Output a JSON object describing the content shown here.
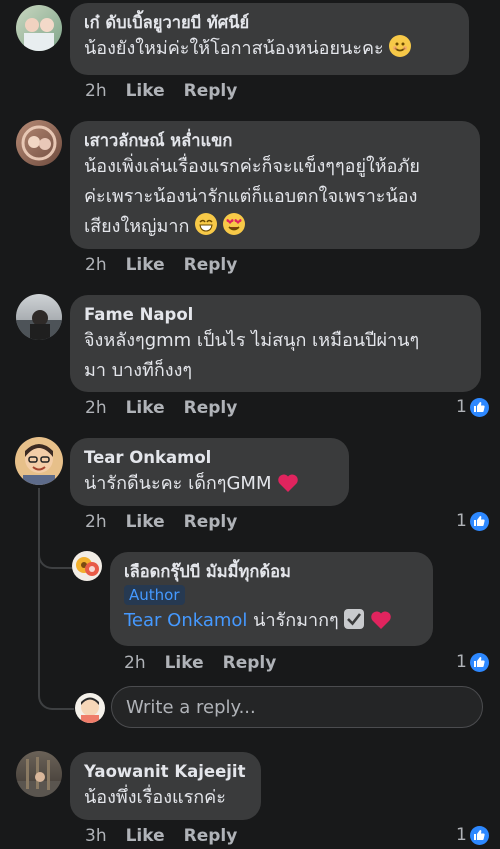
{
  "comments": [
    {
      "name": "เก๋ ดับเบิ้ลยูวายบี ทัศนีย์",
      "lines": [
        "น้องยังใหม่ค่ะให้โอกาสน้องหน่อยนะคะ"
      ],
      "time": "2h",
      "like": "Like",
      "reply": "Reply",
      "reactions": ""
    },
    {
      "name": "เสาวลักษณ์ หล่ำแขก",
      "lines": [
        "น้องเพิ่งเล่นเรื่องแรกค่ะก็จะแข็งๆๆอยู่ให้อภัย",
        "ค่ะเพราะน้องน่ารักแต่ก็แอบตกใจเพราะน้อง",
        "เสียงใหญ่มาก"
      ],
      "time": "2h",
      "like": "Like",
      "reply": "Reply",
      "reactions": ""
    },
    {
      "name": "Fame Napol",
      "lines": [
        "จิงหลังๆgmm เป็นไร ไม่สนุก เหมือนปีผ่านๆ",
        "มา บางทีก็งงๆ"
      ],
      "time": "2h",
      "like": "Like",
      "reply": "Reply",
      "reactions": "1"
    },
    {
      "name": "Tear Onkamol",
      "lines": [
        "น่ารักดีนะคะ เด็กๆGMM"
      ],
      "time": "2h",
      "like": "Like",
      "reply": "Reply",
      "reactions": "1"
    },
    {
      "name": "Yaowanit Kajeejit",
      "lines": [
        "น้องพึ่งเรื่องแรกค่ะ"
      ],
      "time": "3h",
      "like": "Like",
      "reply": "Reply",
      "reactions": "1"
    }
  ],
  "nested_reply": {
    "name": "เลือดกรุ๊ปบี มัมมี้ทุกด้อม",
    "badge": "Author",
    "mention": "Tear Onkamol",
    "text": " น่ารักมากๆ",
    "time": "2h",
    "like": "Like",
    "reply": "Reply",
    "reactions": "1"
  },
  "reply_box": {
    "placeholder": "Write a reply..."
  },
  "colors": {
    "bubble": "#3a3b3c",
    "background": "#18191a",
    "link": "#4599ff",
    "like_badge": "#2d88ff",
    "heart": "#e0245e"
  },
  "icons": [
    "smile-emoji-icon",
    "grin-emoji-icon",
    "heart-eyes-emoji-icon",
    "red-heart-icon",
    "check-mark-icon",
    "like-thumb-icon"
  ]
}
